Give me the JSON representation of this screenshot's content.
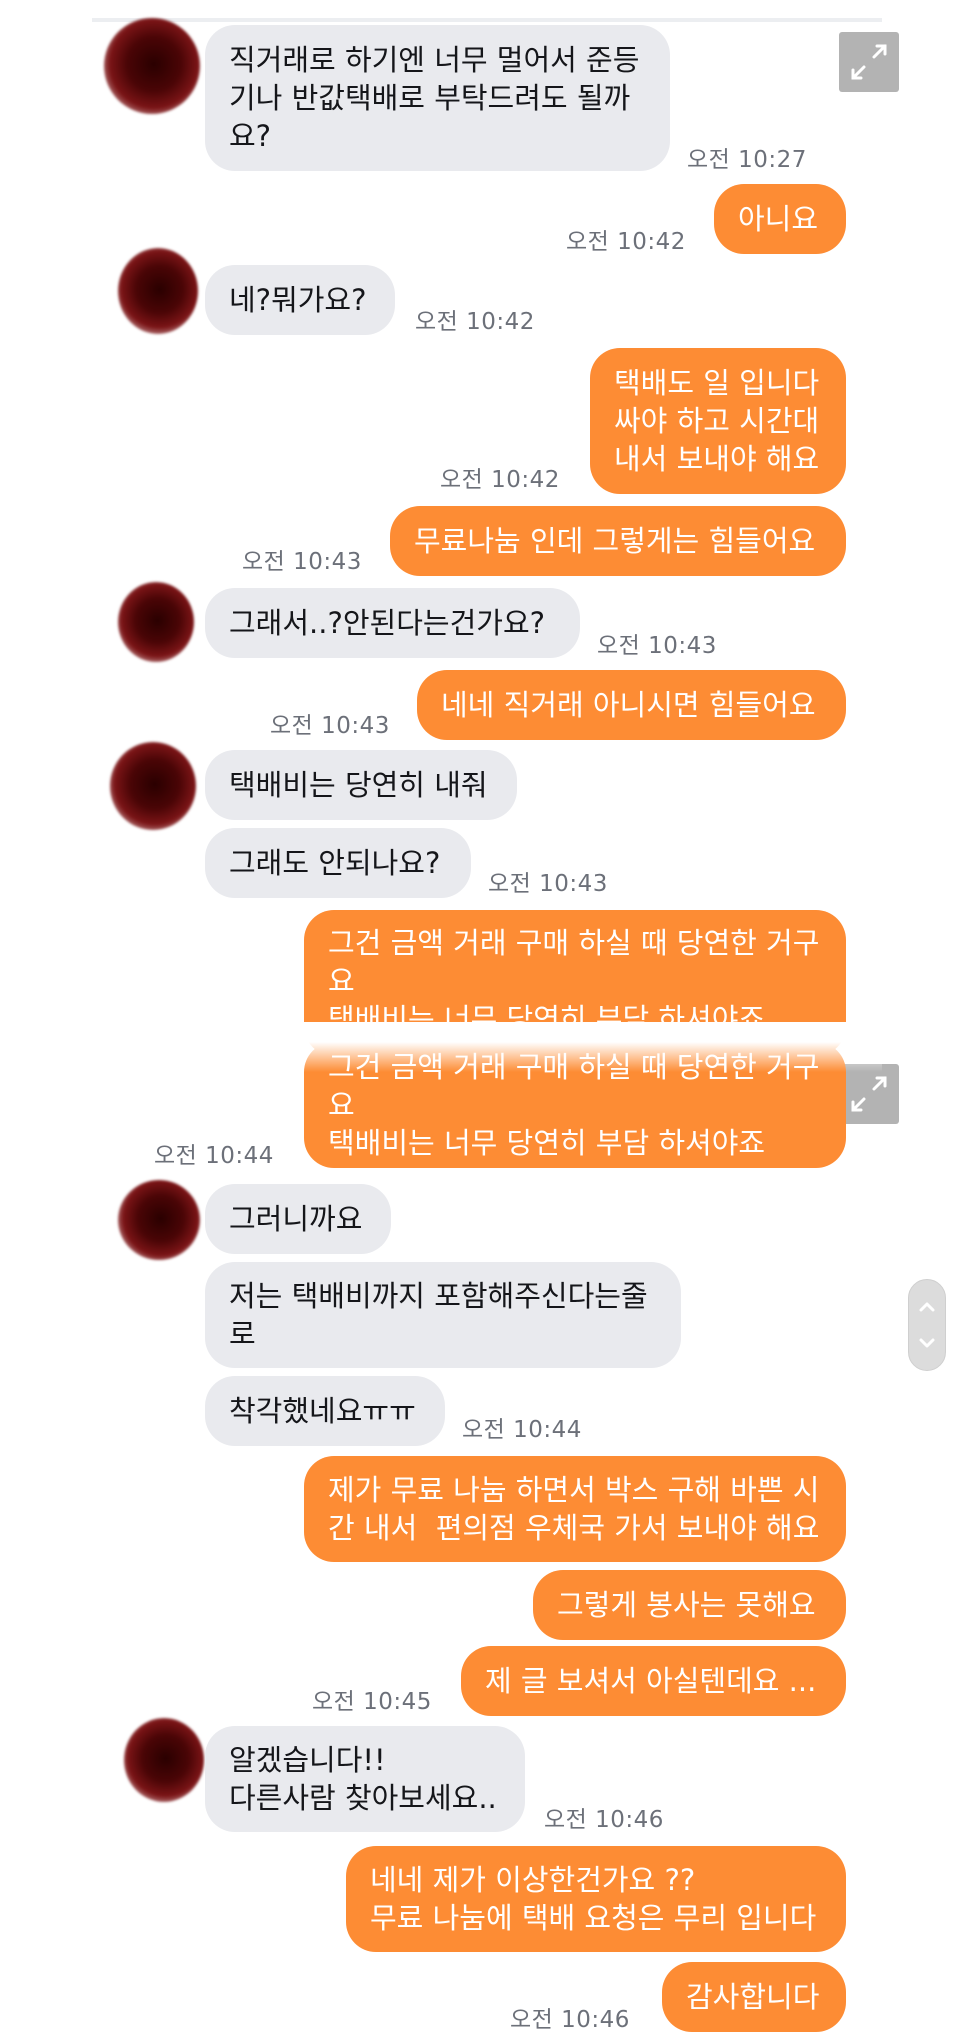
{
  "messages": [
    {
      "side": "in",
      "text": "직거래로 하기엔 너무 멀어서 준등\n기나 반값택배로 부탁드려도 될까\n요?",
      "time": "오전 10:27"
    },
    {
      "side": "out",
      "text": "아니요",
      "time": "오전 10:42"
    },
    {
      "side": "in",
      "text": "네?뭐가요?",
      "time": "오전 10:42"
    },
    {
      "side": "out",
      "text": "택배도 일 입니다\n싸야 하고 시간대\n내서 보내야 해요",
      "time": "오전 10:42"
    },
    {
      "side": "out",
      "text": "무료나눔 인데 그렇게는 힘들어요",
      "time": "오전 10:43"
    },
    {
      "side": "in",
      "text": "그래서..?안된다는건가요?",
      "time": "오전 10:43"
    },
    {
      "side": "out",
      "text": "네네 직거래 아니시면 힘들어요",
      "time": "오전 10:43"
    },
    {
      "side": "in",
      "text": "택배비는 당연히 내줘"
    },
    {
      "side": "in",
      "text": "그래도 안되나요?",
      "time": "오전 10:43"
    },
    {
      "side": "out",
      "text": "그건 금액 거래 구매 하실 때 당연한 거구\n요\n택배비는 너무 당연히 부담 하셔야죠"
    },
    {
      "side": "out",
      "text": "그건 금액 거래 구매 하실 때 당연한 거구\n요\n택배비는 너무 당연히 부담 하셔야죠",
      "time": "오전 10:44"
    },
    {
      "side": "in",
      "text": "그러니까요"
    },
    {
      "side": "in",
      "text": "저는 택배비까지 포함해주신다는줄\n로"
    },
    {
      "side": "in",
      "text": "착각했네요ㅠㅠ",
      "time": "오전 10:44"
    },
    {
      "side": "out",
      "text": "제가 무료 나눔 하면서 박스 구해 바쁜 시\n간 내서  편의점 우체국 가서 보내야 해요"
    },
    {
      "side": "out",
      "text": "그렇게 봉사는 못해요"
    },
    {
      "side": "out",
      "text": "제 글 보셔서 아실텐데요 ...",
      "time": "오전 10:45"
    },
    {
      "side": "in",
      "text": "알겠습니다!!\n다른사람 찾아보세요..",
      "time": "오전 10:46"
    },
    {
      "side": "out",
      "text": "네네 제가 이상한건가요 ??\n무료 나눔에 택배 요청은 무리 입니다"
    },
    {
      "side": "out",
      "text": "감사합니다",
      "time": "오전 10:46"
    }
  ]
}
